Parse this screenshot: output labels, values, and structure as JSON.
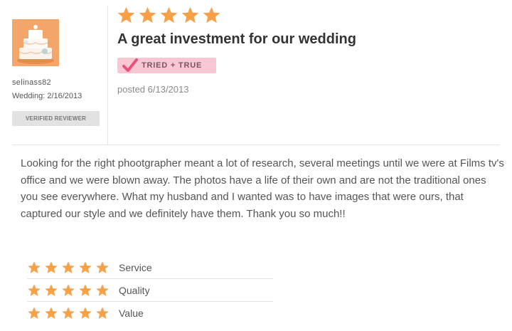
{
  "reviewer": {
    "username": "selinass82",
    "wedding_date": "Wedding: 2/16/2013",
    "verified_label": "VERIFIED REVIEWER",
    "avatar_icon": "wedding-cake-icon"
  },
  "review": {
    "overall_rating": 5,
    "rating_max": 5,
    "title": "A great investment for our wedding",
    "badge_label": "TRIED + TRUE",
    "posted": "posted 6/13/2013",
    "body": "Looking for the right phootgrapher meant a lot of research, several meetings until we were at Films tv's office and we were blown away. The photos have a life of their own and are not the traditional ones you see everywhere. What my husband and I wanted was to have images that were ours, that captured our style and we definitely have them. Thank you so much!!"
  },
  "ratings": [
    {
      "label": "Service",
      "stars": 5
    },
    {
      "label": "Quality",
      "stars": 5
    },
    {
      "label": "Value",
      "stars": 5
    }
  ],
  "colors": {
    "star": "#f7a047",
    "badge_pink": "#f9c7d3",
    "check_pink": "#e8527a",
    "avatar_bg": "#f3a56a"
  }
}
